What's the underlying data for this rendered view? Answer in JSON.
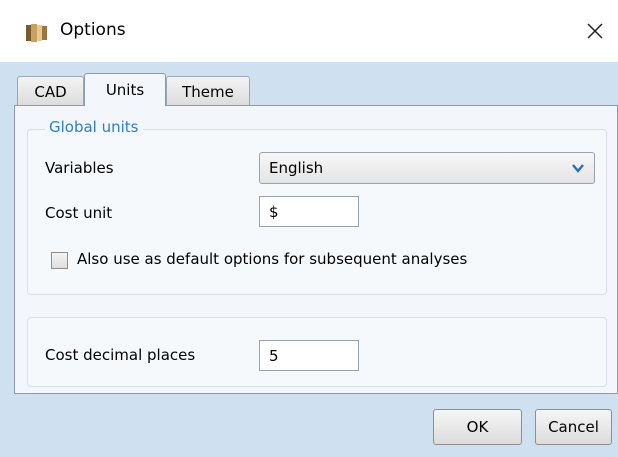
{
  "window": {
    "title": "Options",
    "close_glyph": "✕",
    "icon": "options-app-icon"
  },
  "tabs": [
    {
      "label": "CAD",
      "active": false
    },
    {
      "label": "Units",
      "active": true
    },
    {
      "label": "Theme",
      "active": false
    }
  ],
  "global_units": {
    "legend": "Global units",
    "variables_label": "Variables",
    "variables_value": "English",
    "cost_unit_label": "Cost unit",
    "cost_unit_value": "$",
    "default_checkbox_label": "Also use as default options for subsequent analyses",
    "default_checkbox_checked": false
  },
  "decimals": {
    "label": "Cost decimal places",
    "value": "5"
  },
  "buttons": {
    "ok": "OK",
    "cancel": "Cancel"
  },
  "colors": {
    "accent": "#2c7fc6",
    "client_background": "#cfe0f1",
    "panel_background": "#f3f7fb"
  }
}
